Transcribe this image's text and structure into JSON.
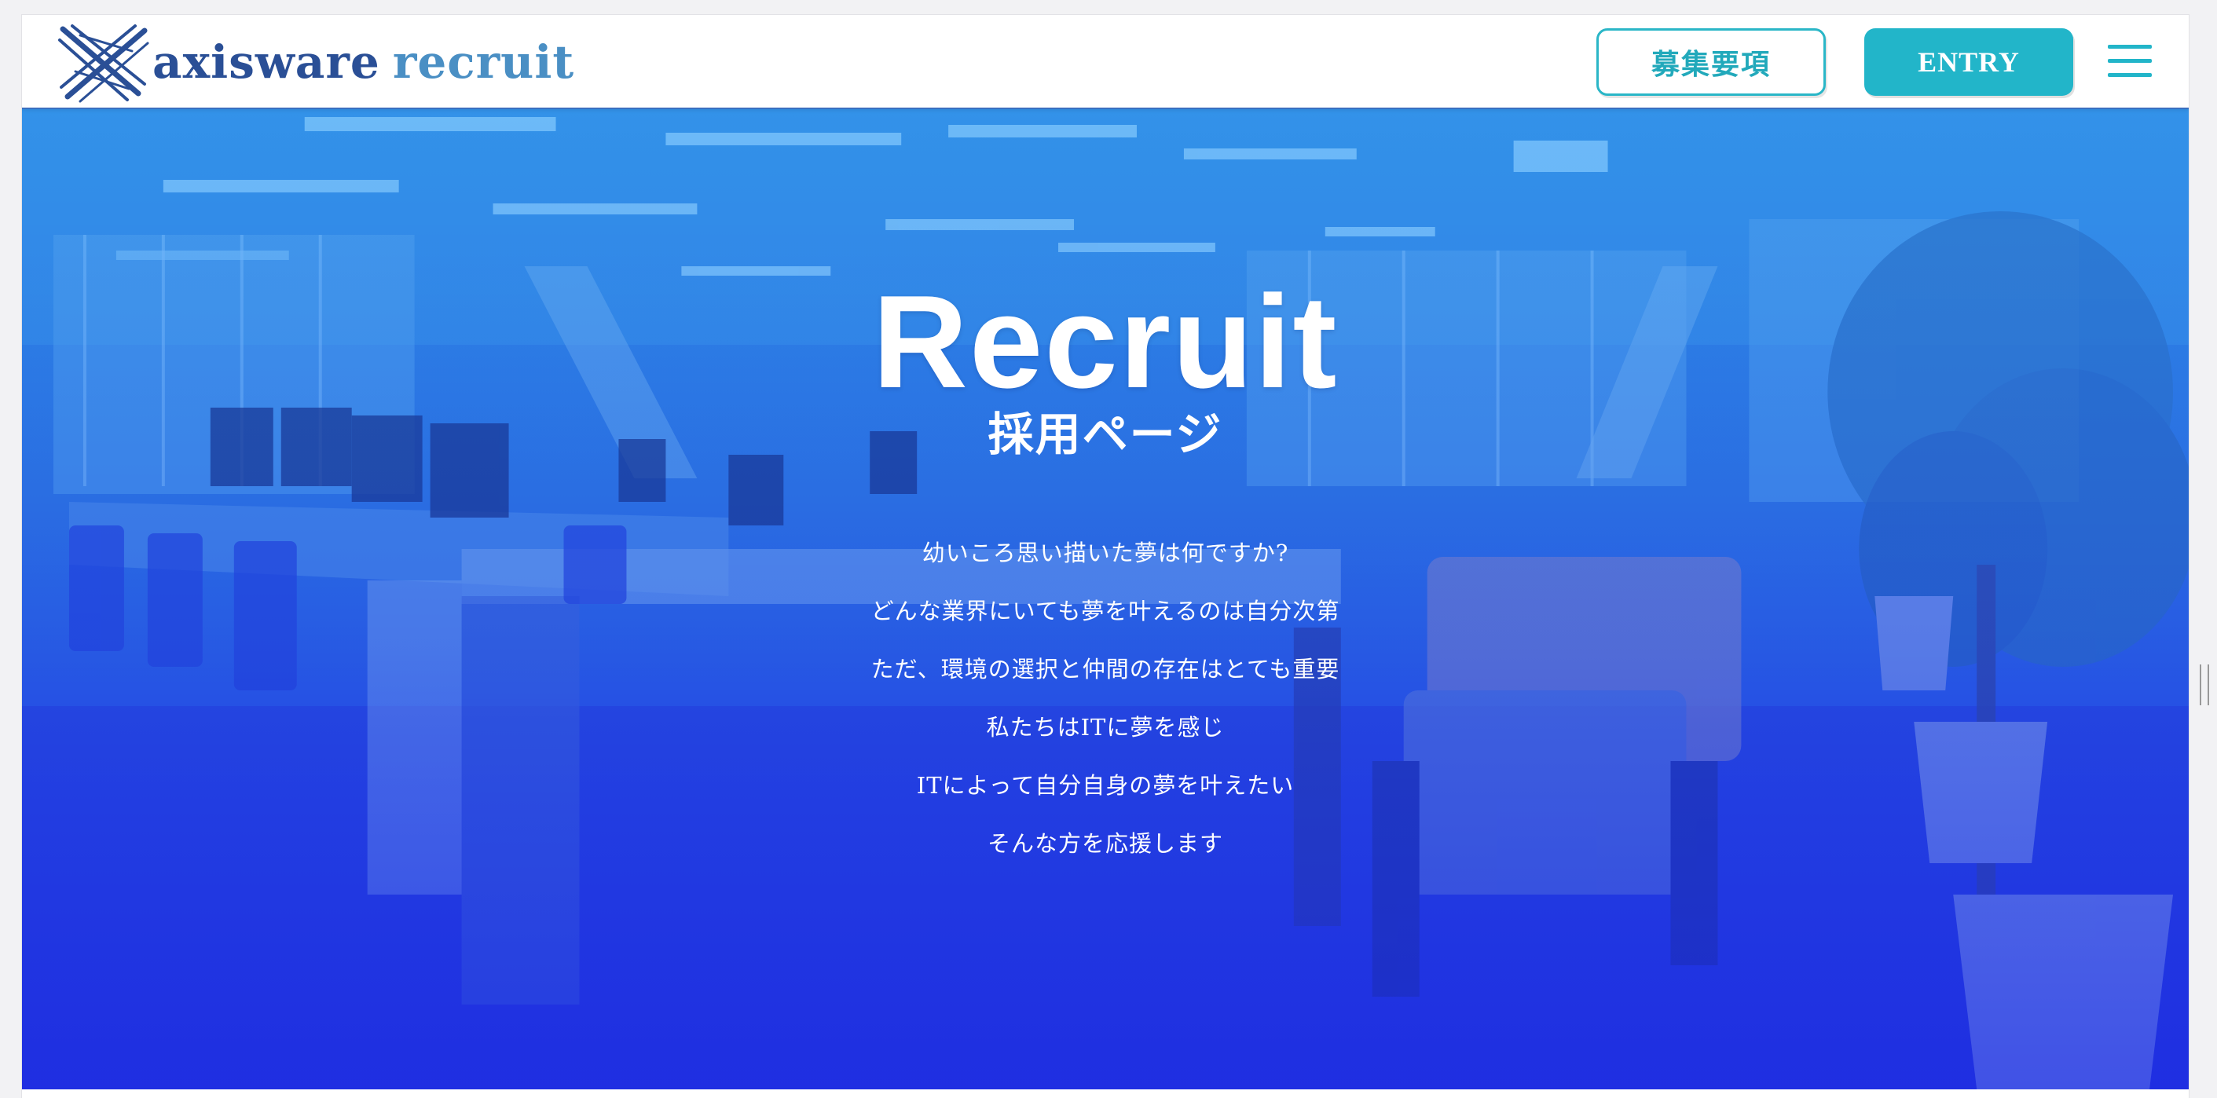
{
  "header": {
    "logo_primary": "axisware",
    "logo_secondary": "recruit",
    "requirements_label": "募集要項",
    "entry_label": "ENTRY"
  },
  "hero": {
    "title": "Recruit",
    "subtitle": "採用ページ",
    "lines": [
      "幼いころ思い描いた夢は何ですか?",
      "どんな業界にいても夢を叶えるのは自分次第",
      "ただ、環境の選択と仲間の存在はとても重要",
      "私たちはITに夢を感じ",
      "ITによって自分自身の夢を叶えたい",
      "そんな方を応援します"
    ]
  },
  "colors": {
    "accent": "#22b5c9",
    "logo_dark": "#2a4f96",
    "logo_light": "#4a8fc4",
    "hero_top": "#2f8ee6",
    "hero_bottom": "#1f2fe0"
  },
  "icons": {
    "logo": "axisware-logo-mark-icon",
    "menu": "hamburger-menu-icon"
  }
}
